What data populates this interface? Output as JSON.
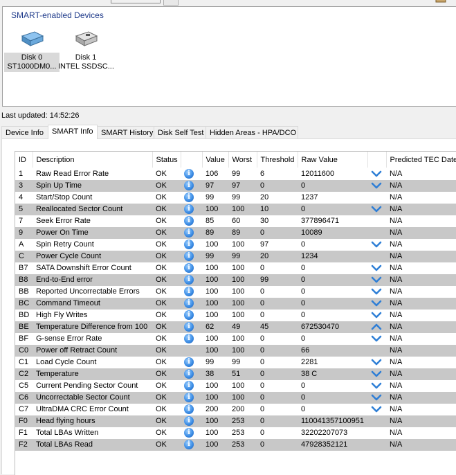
{
  "devices": {
    "title": "SMART-enabled Devices",
    "items": [
      {
        "name": "Disk 0",
        "model": "ST1000DM0...",
        "icon": "hdd-icon",
        "selected": true
      },
      {
        "name": "Disk 1",
        "model": "INTEL SSDSC...",
        "icon": "ssd-icon",
        "selected": false
      }
    ]
  },
  "last_updated": "Last updated: 14:52:26",
  "tabs": [
    {
      "label": "Device Info",
      "active": false
    },
    {
      "label": "SMART Info",
      "active": true
    },
    {
      "label": "SMART History",
      "active": false
    },
    {
      "label": "Disk Self Test",
      "active": false
    },
    {
      "label": "Hidden Areas - HPA/DCO",
      "active": false
    }
  ],
  "table": {
    "columns": [
      "ID",
      "Description",
      "Status",
      "",
      "Value",
      "Worst",
      "Threshold",
      "Raw Value",
      "",
      "Predicted TEC Date"
    ],
    "rows": [
      {
        "id": "1",
        "desc": "Raw Read Error Rate",
        "status": "OK",
        "info": true,
        "value": "106",
        "worst": "99",
        "threshold": "6",
        "raw": "12011600",
        "trend": "down",
        "tec": "N/A"
      },
      {
        "id": "3",
        "desc": "Spin Up Time",
        "status": "OK",
        "info": true,
        "value": "97",
        "worst": "97",
        "threshold": "0",
        "raw": "0",
        "trend": "down",
        "tec": "N/A"
      },
      {
        "id": "4",
        "desc": "Start/Stop Count",
        "status": "OK",
        "info": true,
        "value": "99",
        "worst": "99",
        "threshold": "20",
        "raw": "1237",
        "trend": "",
        "tec": "N/A"
      },
      {
        "id": "5",
        "desc": "Reallocated Sector Count",
        "status": "OK",
        "info": true,
        "value": "100",
        "worst": "100",
        "threshold": "10",
        "raw": "0",
        "trend": "down",
        "tec": "N/A"
      },
      {
        "id": "7",
        "desc": "Seek Error Rate",
        "status": "OK",
        "info": true,
        "value": "85",
        "worst": "60",
        "threshold": "30",
        "raw": "377896471",
        "trend": "",
        "tec": "N/A"
      },
      {
        "id": "9",
        "desc": "Power On Time",
        "status": "OK",
        "info": true,
        "value": "89",
        "worst": "89",
        "threshold": "0",
        "raw": "10089",
        "trend": "",
        "tec": "N/A"
      },
      {
        "id": "A",
        "desc": "Spin Retry Count",
        "status": "OK",
        "info": true,
        "value": "100",
        "worst": "100",
        "threshold": "97",
        "raw": "0",
        "trend": "down",
        "tec": "N/A"
      },
      {
        "id": "C",
        "desc": "Power Cycle Count",
        "status": "OK",
        "info": true,
        "value": "99",
        "worst": "99",
        "threshold": "20",
        "raw": "1234",
        "trend": "",
        "tec": "N/A"
      },
      {
        "id": "B7",
        "desc": "SATA Downshift Error Count",
        "status": "OK",
        "info": true,
        "value": "100",
        "worst": "100",
        "threshold": "0",
        "raw": "0",
        "trend": "down",
        "tec": "N/A"
      },
      {
        "id": "B8",
        "desc": "End-to-End error",
        "status": "OK",
        "info": true,
        "value": "100",
        "worst": "100",
        "threshold": "99",
        "raw": "0",
        "trend": "down",
        "tec": "N/A"
      },
      {
        "id": "BB",
        "desc": "Reported Uncorrectable Errors",
        "status": "OK",
        "info": true,
        "value": "100",
        "worst": "100",
        "threshold": "0",
        "raw": "0",
        "trend": "down",
        "tec": "N/A"
      },
      {
        "id": "BC",
        "desc": "Command Timeout",
        "status": "OK",
        "info": true,
        "value": "100",
        "worst": "100",
        "threshold": "0",
        "raw": "0",
        "trend": "down",
        "tec": "N/A"
      },
      {
        "id": "BD",
        "desc": "High Fly Writes",
        "status": "OK",
        "info": true,
        "value": "100",
        "worst": "100",
        "threshold": "0",
        "raw": "0",
        "trend": "down",
        "tec": "N/A"
      },
      {
        "id": "BE",
        "desc": "Temperature Difference from 100",
        "status": "OK",
        "info": true,
        "value": "62",
        "worst": "49",
        "threshold": "45",
        "raw": "672530470",
        "trend": "up",
        "tec": "N/A"
      },
      {
        "id": "BF",
        "desc": "G-sense Error Rate",
        "status": "OK",
        "info": true,
        "value": "100",
        "worst": "100",
        "threshold": "0",
        "raw": "0",
        "trend": "down",
        "tec": "N/A"
      },
      {
        "id": "C0",
        "desc": "Power off Retract Count",
        "status": "OK",
        "info": false,
        "value": "100",
        "worst": "100",
        "threshold": "0",
        "raw": "66",
        "trend": "",
        "tec": "N/A"
      },
      {
        "id": "C1",
        "desc": "Load Cycle Count",
        "status": "OK",
        "info": true,
        "value": "99",
        "worst": "99",
        "threshold": "0",
        "raw": "2281",
        "trend": "down",
        "tec": "N/A"
      },
      {
        "id": "C2",
        "desc": "Temperature",
        "status": "OK",
        "info": true,
        "value": "38",
        "worst": "51",
        "threshold": "0",
        "raw": "38 C",
        "trend": "down",
        "tec": "N/A"
      },
      {
        "id": "C5",
        "desc": "Current Pending Sector Count",
        "status": "OK",
        "info": true,
        "value": "100",
        "worst": "100",
        "threshold": "0",
        "raw": "0",
        "trend": "down",
        "tec": "N/A"
      },
      {
        "id": "C6",
        "desc": "Uncorrectable Sector Count",
        "status": "OK",
        "info": true,
        "value": "100",
        "worst": "100",
        "threshold": "0",
        "raw": "0",
        "trend": "down",
        "tec": "N/A"
      },
      {
        "id": "C7",
        "desc": "UltraDMA CRC Error Count",
        "status": "OK",
        "info": true,
        "value": "200",
        "worst": "200",
        "threshold": "0",
        "raw": "0",
        "trend": "down",
        "tec": "N/A"
      },
      {
        "id": "F0",
        "desc": "Head flying hours",
        "status": "OK",
        "info": true,
        "value": "100",
        "worst": "253",
        "threshold": "0",
        "raw": "110041357100951",
        "trend": "",
        "tec": "N/A"
      },
      {
        "id": "F1",
        "desc": "Total LBAs Written",
        "status": "OK",
        "info": true,
        "value": "100",
        "worst": "253",
        "threshold": "0",
        "raw": "32202207073",
        "trend": "",
        "tec": "N/A"
      },
      {
        "id": "F2",
        "desc": "Total LBAs Read",
        "status": "OK",
        "info": true,
        "value": "100",
        "worst": "253",
        "threshold": "0",
        "raw": "47928352121",
        "trend": "",
        "tec": "N/A"
      }
    ]
  },
  "colors": {
    "accent_title": "#1e3a8a",
    "row_alt": "#c8c8c8",
    "info_blue": "#3d8ee6",
    "chevron_blue": "#2f7fd6"
  }
}
